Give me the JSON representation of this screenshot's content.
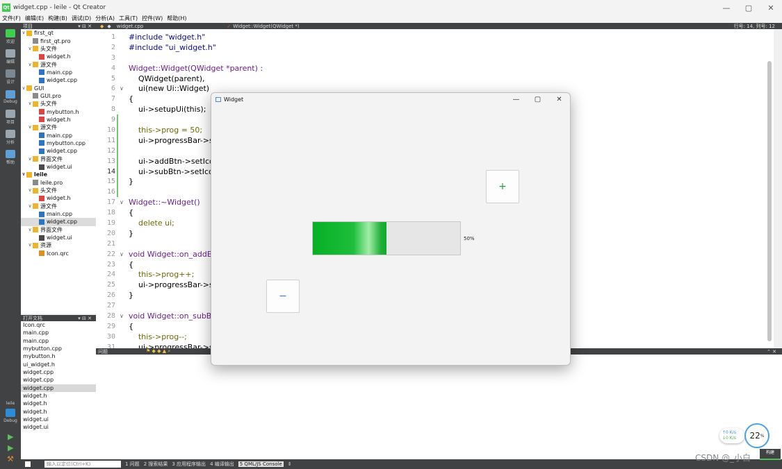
{
  "window": {
    "title": "widget.cpp - leile - Qt Creator",
    "app_icon": "Qt",
    "controls": [
      "—",
      "▢",
      "✕"
    ]
  },
  "menu": [
    "文件(F)",
    "编辑(E)",
    "构建(B)",
    "调试(D)",
    "分析(A)",
    "工具(T)",
    "控件(W)",
    "帮助(H)"
  ],
  "modes": [
    {
      "label": "欢迎",
      "icon": "qt-welcome-icon",
      "color": "#41cd52"
    },
    {
      "label": "编辑",
      "icon": "edit-icon",
      "color": "#9aa7b0"
    },
    {
      "label": "设计",
      "icon": "design-icon",
      "color": "#7c8891"
    },
    {
      "label": "Debug",
      "icon": "debug-icon",
      "color": "#5f9fd6"
    },
    {
      "label": "项目",
      "icon": "project-icon",
      "color": "#9aa7b0"
    },
    {
      "label": "分析",
      "icon": "analyze-icon",
      "color": "#9aa7b0"
    },
    {
      "label": "帮助",
      "icon": "help-icon",
      "color": "#5f9fd6"
    }
  ],
  "kit": {
    "project": "leile",
    "mode": "Debug"
  },
  "project_panel": {
    "header": "项目"
  },
  "tree": [
    {
      "t": "first_qt",
      "d": 0,
      "k": "proj",
      "open": true
    },
    {
      "t": "first_qt.pro",
      "d": 1,
      "k": "pro"
    },
    {
      "t": "头文件",
      "d": 1,
      "k": "folder",
      "open": true
    },
    {
      "t": "widget.h",
      "d": 2,
      "k": "h"
    },
    {
      "t": "源文件",
      "d": 1,
      "k": "folder",
      "open": true
    },
    {
      "t": "main.cpp",
      "d": 2,
      "k": "cpp"
    },
    {
      "t": "widget.cpp",
      "d": 2,
      "k": "cpp"
    },
    {
      "t": "GUI",
      "d": 0,
      "k": "proj",
      "open": true
    },
    {
      "t": "GUI.pro",
      "d": 1,
      "k": "pro"
    },
    {
      "t": "头文件",
      "d": 1,
      "k": "folder",
      "open": true
    },
    {
      "t": "mybutton.h",
      "d": 2,
      "k": "h"
    },
    {
      "t": "widget.h",
      "d": 2,
      "k": "h"
    },
    {
      "t": "源文件",
      "d": 1,
      "k": "folder",
      "open": true
    },
    {
      "t": "main.cpp",
      "d": 2,
      "k": "cpp"
    },
    {
      "t": "mybutton.cpp",
      "d": 2,
      "k": "cpp"
    },
    {
      "t": "widget.cpp",
      "d": 2,
      "k": "cpp"
    },
    {
      "t": "界面文件",
      "d": 1,
      "k": "folder",
      "open": true
    },
    {
      "t": "widget.ui",
      "d": 2,
      "k": "ui"
    },
    {
      "t": "leile",
      "d": 0,
      "k": "proj",
      "open": true,
      "bold": true
    },
    {
      "t": "leile.pro",
      "d": 1,
      "k": "pro"
    },
    {
      "t": "头文件",
      "d": 1,
      "k": "folder",
      "open": true
    },
    {
      "t": "widget.h",
      "d": 2,
      "k": "h"
    },
    {
      "t": "源文件",
      "d": 1,
      "k": "folder",
      "open": true
    },
    {
      "t": "main.cpp",
      "d": 2,
      "k": "cpp"
    },
    {
      "t": "widget.cpp",
      "d": 2,
      "k": "cpp",
      "sel": true
    },
    {
      "t": "界面文件",
      "d": 1,
      "k": "folder",
      "open": true
    },
    {
      "t": "widget.ui",
      "d": 2,
      "k": "ui"
    },
    {
      "t": "资源",
      "d": 1,
      "k": "folder",
      "open": true
    },
    {
      "t": "Icon.qrc",
      "d": 2,
      "k": "qrc"
    }
  ],
  "open_docs": {
    "header": "打开文档",
    "items": [
      "Icon.qrc",
      "main.cpp",
      "main.cpp",
      "mybutton.cpp",
      "mybutton.h",
      "ui_widget.h",
      "widget.cpp",
      "widget.cpp",
      "widget.cpp",
      "widget.h",
      "widget.h",
      "widget.h",
      "widget.ui",
      "widget.ui"
    ],
    "selected_index": 8
  },
  "editor": {
    "file": "widget.cpp",
    "symbol": "Widget::Widget(QWidget *)",
    "position": "行号: 14, 列号: 12",
    "lines": [
      "#include \"widget.h\"",
      "#include \"ui_widget.h\"",
      "",
      "Widget::Widget(QWidget *parent) :",
      "    QWidget(parent),",
      "    ui(new Ui::Widget)",
      "{",
      "    ui->setupUi(this);",
      "",
      "    this->prog = 50;",
      "    ui->progressBar->s",
      "",
      "    ui->addBtn->setIco",
      "    ui->subBtn->setIco",
      "}",
      "",
      "Widget::~Widget()",
      "{",
      "    delete ui;",
      "}",
      "",
      "void Widget::on_addBt",
      "{",
      "    this->prog++;",
      "    ui->progressBar->s",
      "}",
      "",
      "void Widget::on_subBt",
      "{",
      "    this->prog--;",
      "    ui->progressBar->s"
    ],
    "line_numbers": [
      "1",
      "2",
      "3",
      "4",
      "5",
      "6",
      "7",
      "8",
      "9",
      "10",
      "11",
      "12",
      "13",
      "14",
      "15",
      "16",
      "17",
      "18",
      "19",
      "20",
      "21",
      "22",
      "23",
      "24",
      "25",
      "26",
      "27",
      "28",
      "29",
      "30",
      "31"
    ],
    "folds": [
      "",
      "",
      "",
      "",
      "",
      "∨",
      "",
      "",
      "",
      "",
      "",
      "",
      "",
      "",
      "",
      "",
      "∨",
      "",
      "",
      "",
      "",
      "∨",
      "",
      "",
      "",
      "",
      "",
      "∨",
      "",
      "",
      ""
    ]
  },
  "issues_panel": {
    "header": "问题"
  },
  "locator": {
    "placeholder": "输入以定位(Ctrl+K)"
  },
  "output_tabs": [
    "1 问题",
    "2 搜索结果",
    "3 应用程序输出",
    "4 编译输出",
    "5 QML/JS Console"
  ],
  "widget_app": {
    "title": "Widget",
    "add_label": "+",
    "sub_label": "−",
    "progress": 50,
    "progress_text": "50%",
    "colors": {
      "add": "#18a43a",
      "sub": "#3a7bd5"
    }
  },
  "tray": {
    "up": "↑0 K/s",
    "down": "↓0 K/s",
    "cpu": "22",
    "cpu_unit": "%",
    "watermark": "CSDN @_小白",
    "build": "构建"
  }
}
